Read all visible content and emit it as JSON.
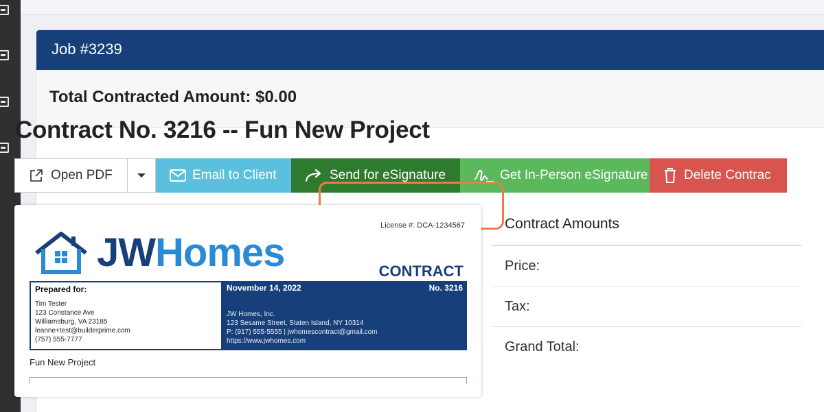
{
  "job": {
    "title": "Job #3239"
  },
  "summary": {
    "total_contracted": "Total Contracted Amount: $0.00"
  },
  "contract": {
    "title": "Contract No. 3216 -- Fun New Project"
  },
  "toolbar": {
    "open_pdf": "Open PDF",
    "email_client": "Email to Client",
    "send_esignature": "Send for eSignature",
    "in_person_esignature": "Get In-Person eSignature",
    "delete_contract": "Delete Contrac"
  },
  "document": {
    "license": "License #: DCA-1234567",
    "logo_jw": "JW",
    "logo_homes": "Homes",
    "contract_label": "CONTRACT",
    "prepared_for_title": "Prepared for:",
    "prepared_for_lines": [
      "Tim Tester",
      "123 Constance Ave",
      "Williamsburg, VA 23185",
      "leanne+test@builderprime.com",
      "(757) 555-7777"
    ],
    "date": "November 14, 2022",
    "number": "No. 3216",
    "company_lines": [
      "JW Homes, Inc.",
      "123 Sesame Street, Staten Island, NY 10314",
      "P: (917) 555-5555 | jwhomescontract@gmail.com",
      "https://www.jwhomes.com"
    ],
    "project_name": "Fun New Project"
  },
  "amounts": {
    "header": "Contract Amounts",
    "rows": [
      "Price:",
      "Tax:",
      "Grand Total:"
    ]
  },
  "colors": {
    "header_blue": "#17407a",
    "email": "#5bc0de",
    "send": "#2e7a2f",
    "in_person": "#5cb85c",
    "delete": "#d9534f",
    "highlight": "#ef7b45"
  }
}
